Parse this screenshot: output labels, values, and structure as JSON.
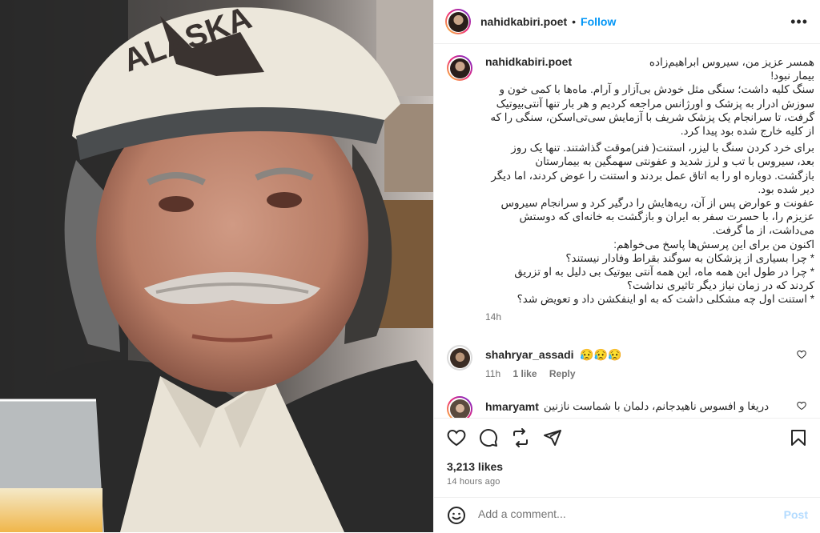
{
  "post": {
    "author": "nahidkabiri.poet",
    "follow_label": "Follow",
    "dot": "•",
    "more_icon": "more-horizontal-icon"
  },
  "caption": {
    "user": "nahidkabiri.poet",
    "lines": [
      "همسر عزیز من، سیروس ابراهیم‌زاده",
      "بیمار نبود!",
      "سنگ کلیه داشت؛ سنگی مثل خودش بی‌آزار و آرام. ماه‌ها با کمی خون و",
      "سوزش ادرار به پزشک و اورژانس مراجعه کردیم و هر بار تنها آنتی‌بیوتیک",
      "گرفت، تا سرانجام یک پزشک شریف با آزمایش سی‌تی‌اسکن، سنگی را که",
      "از کلیه خارج شده بود پیدا کرد.",
      "برای خرد کردن سنگ با لیزر، استنت( فنر)موقت گذاشتند. تنها یک روز",
      "بعد، سیروس با تب و لرز شدید و عفونتی سهمگین به بیمارستان",
      "بازگشت. دوباره او را به اتاق عمل بردند و استنت را عوض کردند، اما دیگر",
      "دیر شده بود.",
      "عفونت و عوارض پس از آن، ریه‌هایش را درگیر کرد و سرانجام سیروس",
      "عزیزم را، با حسرت سفر به ایران و بازگشت به خانه‌ای که دوستش",
      "می‌داشت، از ما گرفت.",
      "اکنون من برای این پرسش‌ها پاسخ می‌خواهم:",
      "* چرا بسیاری از پزشکان به سوگند بقراط وفادار نیستند؟",
      "* چرا در طول این همه ماه، این همه آنتی بیوتیک بی دلیل به او تزریق",
      "کردند که در زمان نیاز دیگر تاثیری نداشت؟",
      "* استنت اول چه مشکلی داشت که به او اینفکشن داد و تعویض شد؟"
    ],
    "time": "14h"
  },
  "comments": [
    {
      "user": "shahryar_assadi",
      "text": "😥😥😥",
      "time": "11h",
      "likes": "1 like",
      "reply": "Reply"
    },
    {
      "user": "hmaryamt",
      "text": "دریغا و افسوس ناهیدجانم، دلمان با شماست نازنین"
    }
  ],
  "actions": {
    "icons": [
      "heart-icon",
      "comment-icon",
      "share-icon",
      "send-icon",
      "bookmark-icon"
    ]
  },
  "likes": "3,213 likes",
  "posted_ago": "14 hours ago",
  "add_comment": {
    "placeholder": "Add a comment...",
    "post_label": "Post"
  },
  "colors": {
    "follow": "#0095f6",
    "post_disabled": "#b3dbff",
    "secondary_text": "#737373",
    "border": "#efefef"
  }
}
